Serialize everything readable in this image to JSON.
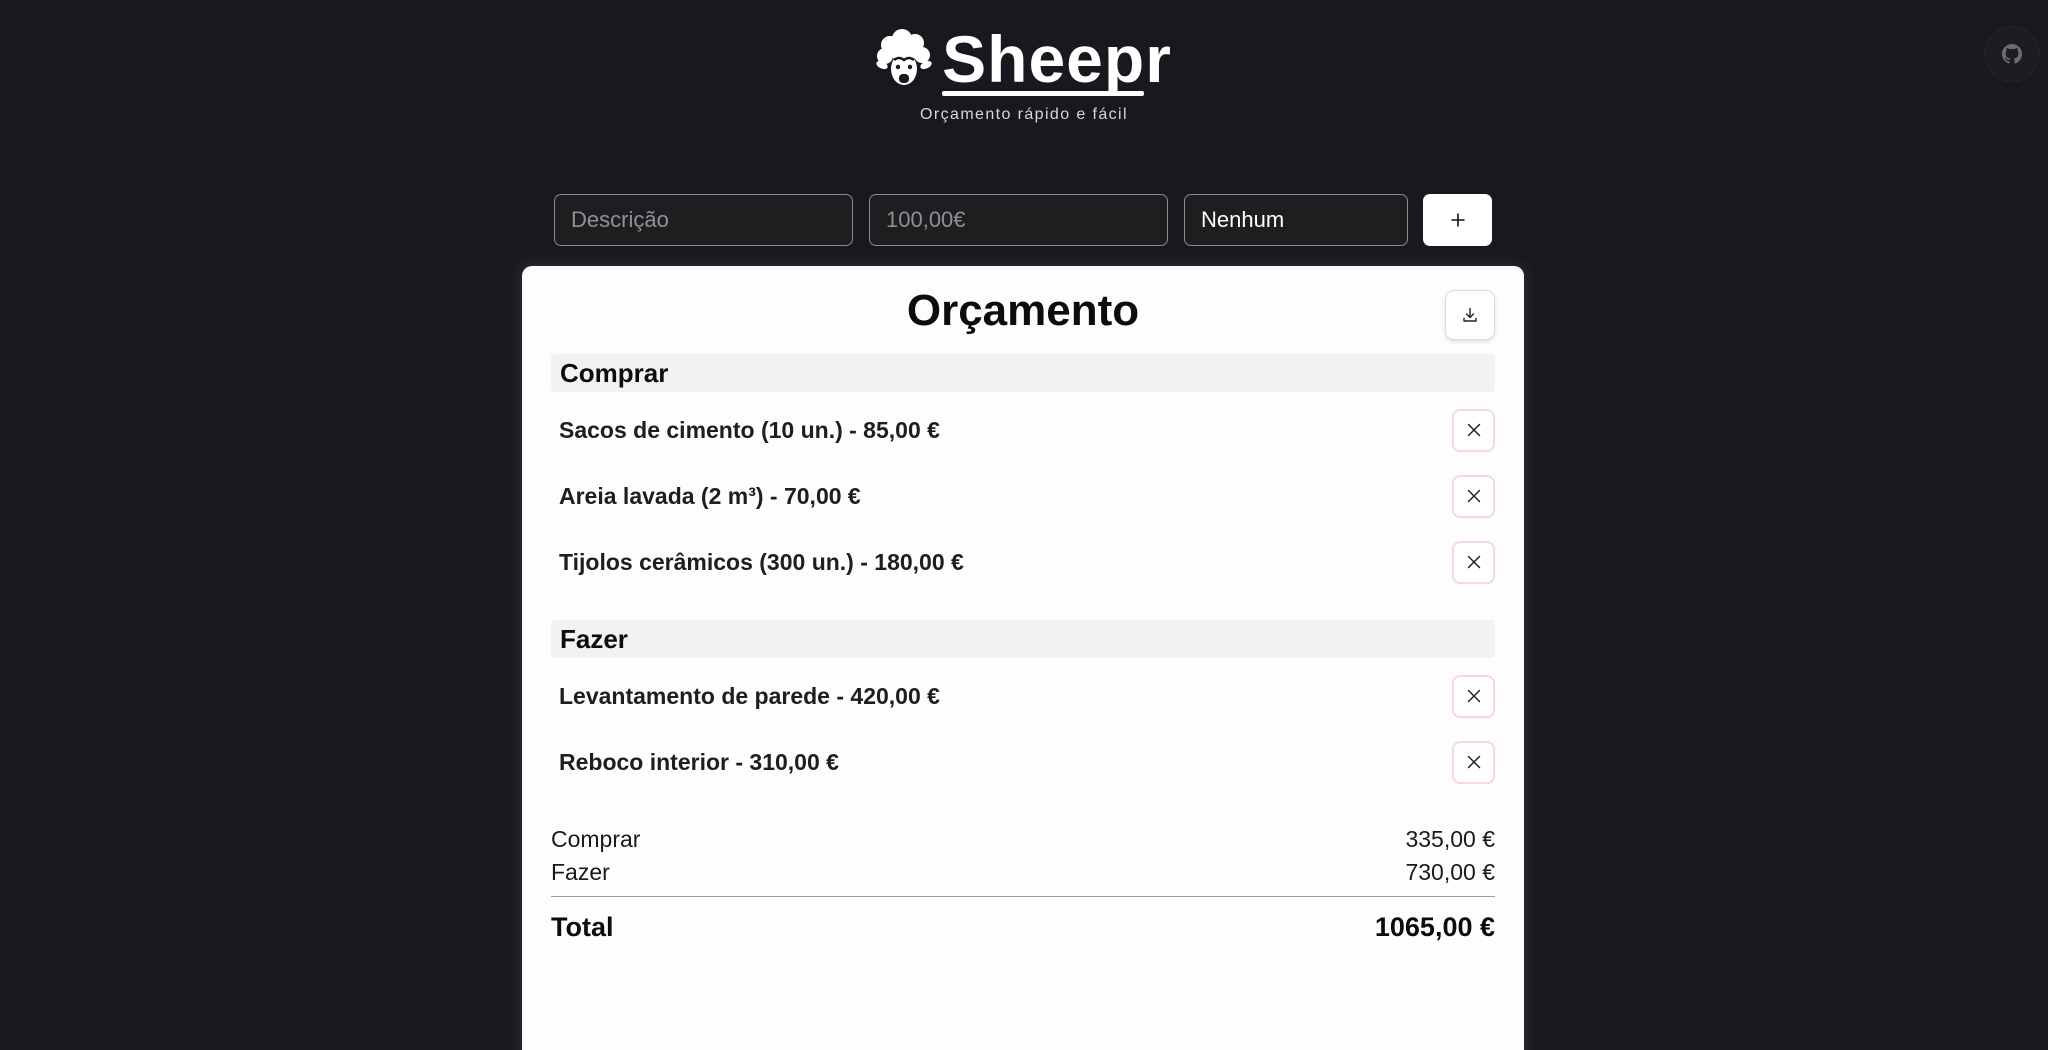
{
  "header": {
    "brand": "Sheepr",
    "tagline": "Orçamento rápido e fácil"
  },
  "form": {
    "description_placeholder": "Descrição",
    "price_placeholder": "100,00€",
    "category_value": "Nenhum",
    "add_label": "+"
  },
  "budget": {
    "title": "Orçamento",
    "sections": [
      {
        "name": "Comprar",
        "items": [
          "Sacos de cimento (10 un.) - 85,00 €",
          "Areia lavada (2 m³) - 70,00 €",
          "Tijolos cerâmicos (300 un.) - 180,00 €"
        ]
      },
      {
        "name": "Fazer",
        "items": [
          "Levantamento de parede - 420,00 €",
          "Reboco interior - 310,00 €"
        ]
      }
    ],
    "summary": [
      {
        "label": "Comprar",
        "value": "335,00 €"
      },
      {
        "label": "Fazer",
        "value": "730,00 €"
      }
    ],
    "total_label": "Total",
    "total_value": "1065,00 €"
  },
  "icons": {
    "brand": "sheep-icon",
    "github": "github-icon",
    "add": "plus-icon",
    "download": "download-icon",
    "remove": "close-icon"
  },
  "colors": {
    "background": "#18191e",
    "card": "#fdfdfd",
    "remove_border": "#f5d9dc"
  }
}
